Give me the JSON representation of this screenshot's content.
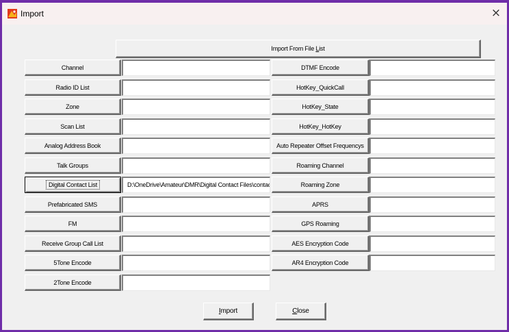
{
  "window": {
    "title": "Import",
    "close_glyph": "×"
  },
  "top_button": {
    "prefix": "Import From File ",
    "mnemonic": "L",
    "suffix": "ist"
  },
  "left_rows": [
    {
      "label": "Channel",
      "value": ""
    },
    {
      "label": "Radio ID List",
      "value": ""
    },
    {
      "label": "Zone",
      "value": ""
    },
    {
      "label": "Scan List",
      "value": ""
    },
    {
      "label": "Analog Address Book",
      "value": ""
    },
    {
      "label": "Talk Groups",
      "value": ""
    },
    {
      "label": "Digital Contact List",
      "value": "D:\\OneDrive\\Amateur\\DMR\\Digital Contact Files\\contac"
    },
    {
      "label": "Prefabricated SMS",
      "value": ""
    },
    {
      "label": "FM",
      "value": ""
    },
    {
      "label": "Receive Group Call List",
      "value": ""
    },
    {
      "label": "5Tone Encode",
      "value": ""
    },
    {
      "label": "2Tone Encode",
      "value": ""
    }
  ],
  "right_rows": [
    {
      "label": "DTMF Encode",
      "value": ""
    },
    {
      "label": "HotKey_QuickCall",
      "value": ""
    },
    {
      "label": "HotKey_State",
      "value": ""
    },
    {
      "label": "HotKey_HotKey",
      "value": ""
    },
    {
      "label": "Auto Repeater Offset Frequencys",
      "value": ""
    },
    {
      "label": "Roaming Channel",
      "value": ""
    },
    {
      "label": "Roaming Zone",
      "value": ""
    },
    {
      "label": "APRS",
      "value": ""
    },
    {
      "label": "GPS Roaming",
      "value": ""
    },
    {
      "label": "AES Encryption Code",
      "value": ""
    },
    {
      "label": "AR4 Encryption Code",
      "value": ""
    }
  ],
  "actions": {
    "import": {
      "mnemonic": "I",
      "rest": "mport"
    },
    "close": {
      "mnemonic": "C",
      "rest": "lose"
    }
  },
  "icons": {
    "app": "app-logo-icon",
    "close": "close-icon"
  },
  "colors": {
    "window_border": "#6f2da8",
    "dialog_bg": "#f0f0f0"
  }
}
